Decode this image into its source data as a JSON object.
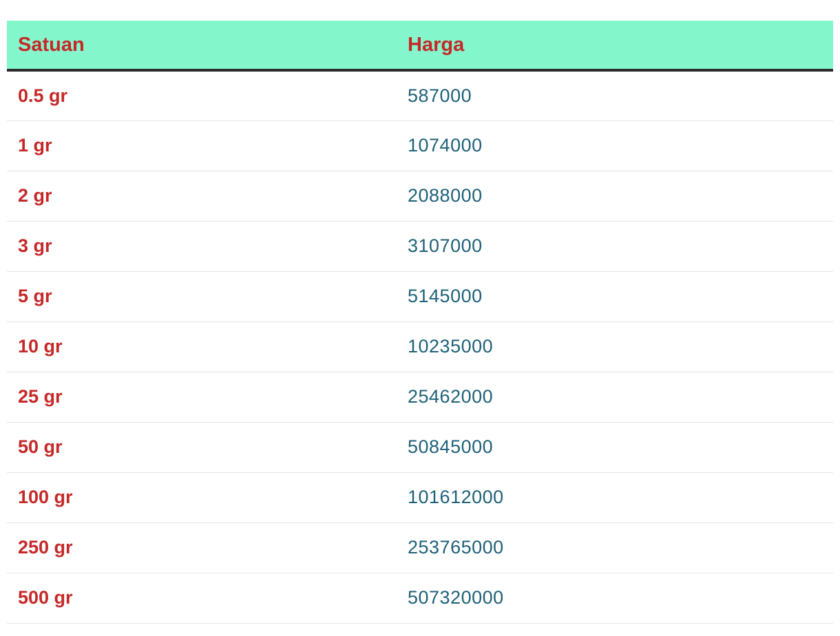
{
  "table": {
    "headers": [
      "Satuan",
      "Harga"
    ],
    "rows": [
      [
        "0.5 gr",
        "587000"
      ],
      [
        "1 gr",
        "1074000"
      ],
      [
        "2 gr",
        "2088000"
      ],
      [
        "3 gr",
        "3107000"
      ],
      [
        "5 gr",
        "5145000"
      ],
      [
        "10 gr",
        "10235000"
      ],
      [
        "25 gr",
        "25462000"
      ],
      [
        "50 gr",
        "50845000"
      ],
      [
        "100 gr",
        "101612000"
      ],
      [
        "250 gr",
        "253765000"
      ],
      [
        "500 gr",
        "507320000"
      ]
    ]
  },
  "colors": {
    "header_bg": "#84f6cc",
    "header_text": "#c62828",
    "unit_text": "#c62828",
    "price_text": "#1f6178"
  }
}
